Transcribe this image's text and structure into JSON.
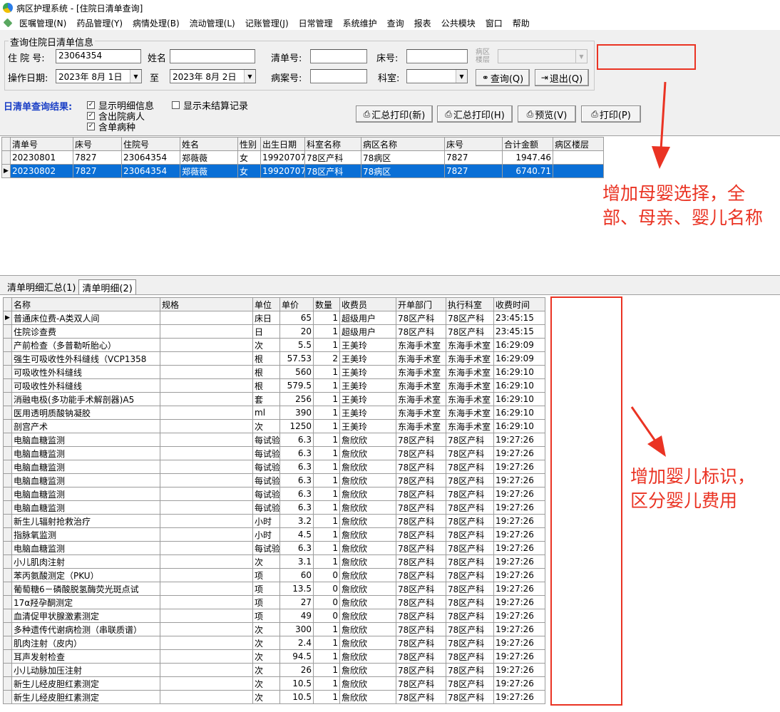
{
  "window": {
    "title": "病区护理系统 - [住院日清单查询]"
  },
  "menu": [
    "医嘱管理(N)",
    "药品管理(Y)",
    "病情处理(B)",
    "流动管理(L)",
    "记账管理(J)",
    "日常管理",
    "系统维护",
    "查询",
    "报表",
    "公共模块",
    "窗口",
    "帮助"
  ],
  "query": {
    "group_title": "查询住院日清单信息",
    "admission_no_label": "住 院 号:",
    "admission_no": "23064354",
    "name_label": "姓名",
    "name_value": "",
    "list_no_label": "清单号:",
    "list_no": "",
    "bed_no_label": "床号:",
    "bed_no": "",
    "ward_floor_label_1": "病区",
    "ward_floor_label_2": "楼层",
    "ward_floor": "",
    "op_date_label": "操作日期:",
    "date_from": "2023年 8月 1日",
    "to_label": "至",
    "date_to": "2023年 8月 2日",
    "case_no_label": "病案号:",
    "case_no": "",
    "dept_label": "科室:",
    "dept": "",
    "query_btn": "查询(Q)",
    "exit_btn": "退出(Q)"
  },
  "results": {
    "label": "日清单查询结果:",
    "checks": [
      {
        "label": "显示明细信息",
        "checked": true
      },
      {
        "label": "含出院病人",
        "checked": true
      },
      {
        "label": "含单病种",
        "checked": true
      },
      {
        "label": "显示未结算记录",
        "checked": false
      }
    ],
    "buttons": [
      "汇总打印(新)",
      "汇总打印(H)",
      "预览(V)",
      "打印(P)"
    ]
  },
  "summary_table": {
    "headers": [
      "清单号",
      "床号",
      "住院号",
      "姓名",
      "性别",
      "出生日期",
      "科室名称",
      "病区名称",
      "床号",
      "合计金额",
      "病区楼层"
    ],
    "rows": [
      [
        "20230801",
        "7827",
        "23064354",
        "郑薇薇",
        "女",
        "19920707",
        "78区产科",
        "78病区",
        "7827",
        "1947.46",
        ""
      ],
      [
        "20230802",
        "7827",
        "23064354",
        "郑薇薇",
        "女",
        "19920707",
        "78区产科",
        "78病区",
        "7827",
        "6740.71",
        ""
      ]
    ],
    "selected_row": 1
  },
  "tabs": [
    "清单明细汇总(1)",
    "清单明细(2)"
  ],
  "active_tab": 1,
  "detail_table": {
    "headers": [
      "名称",
      "规格",
      "单位",
      "单价",
      "数量",
      "收费员",
      "开单部门",
      "执行科室",
      "收费时间"
    ],
    "rows": [
      [
        "普通床位费-A类双人间",
        "",
        "床日",
        "65",
        "1",
        "超级用户",
        "78区产科",
        "78区产科",
        "23:45:15"
      ],
      [
        "住院诊查费",
        "",
        "日",
        "20",
        "1",
        "超级用户",
        "78区产科",
        "78区产科",
        "23:45:15"
      ],
      [
        "产前检查（多普勒听胎心）",
        "",
        "次",
        "5.5",
        "1",
        "王美玲",
        "东海手术室",
        "东海手术室",
        "16:29:09"
      ],
      [
        "强生可吸收性外科缝线（VCP1358",
        "",
        "根",
        "57.53",
        "2",
        "王美玲",
        "东海手术室",
        "东海手术室",
        "16:29:09"
      ],
      [
        "可吸收性外科缝线",
        "",
        "根",
        "560",
        "1",
        "王美玲",
        "东海手术室",
        "东海手术室",
        "16:29:10"
      ],
      [
        "可吸收性外科缝线",
        "",
        "根",
        "579.5",
        "1",
        "王美玲",
        "东海手术室",
        "东海手术室",
        "16:29:10"
      ],
      [
        "消融电极(多功能手术解剖器)A5",
        "",
        "套",
        "256",
        "1",
        "王美玲",
        "东海手术室",
        "东海手术室",
        "16:29:10"
      ],
      [
        "医用透明质酸钠凝胶",
        "",
        "ml",
        "390",
        "1",
        "王美玲",
        "东海手术室",
        "东海手术室",
        "16:29:10"
      ],
      [
        "剖宫产术",
        "",
        "次",
        "1250",
        "1",
        "王美玲",
        "东海手术室",
        "东海手术室",
        "16:29:10"
      ],
      [
        "电脑血糖监测",
        "",
        "每试验",
        "6.3",
        "1",
        "詹欣欣",
        "78区产科",
        "78区产科",
        "19:27:26"
      ],
      [
        "电脑血糖监测",
        "",
        "每试验",
        "6.3",
        "1",
        "詹欣欣",
        "78区产科",
        "78区产科",
        "19:27:26"
      ],
      [
        "电脑血糖监测",
        "",
        "每试验",
        "6.3",
        "1",
        "詹欣欣",
        "78区产科",
        "78区产科",
        "19:27:26"
      ],
      [
        "电脑血糖监测",
        "",
        "每试验",
        "6.3",
        "1",
        "詹欣欣",
        "78区产科",
        "78区产科",
        "19:27:26"
      ],
      [
        "电脑血糖监测",
        "",
        "每试验",
        "6.3",
        "1",
        "詹欣欣",
        "78区产科",
        "78区产科",
        "19:27:26"
      ],
      [
        "电脑血糖监测",
        "",
        "每试验",
        "6.3",
        "1",
        "詹欣欣",
        "78区产科",
        "78区产科",
        "19:27:26"
      ],
      [
        "新生儿辐射抢救治疗",
        "",
        "小时",
        "3.2",
        "1",
        "詹欣欣",
        "78区产科",
        "78区产科",
        "19:27:26"
      ],
      [
        "指脉氧监测",
        "",
        "小时",
        "4.5",
        "1",
        "詹欣欣",
        "78区产科",
        "78区产科",
        "19:27:26"
      ],
      [
        "电脑血糖监测",
        "",
        "每试验",
        "6.3",
        "1",
        "詹欣欣",
        "78区产科",
        "78区产科",
        "19:27:26"
      ],
      [
        "小儿肌肉注射",
        "",
        "次",
        "3.1",
        "1",
        "詹欣欣",
        "78区产科",
        "78区产科",
        "19:27:26"
      ],
      [
        "苯丙氨酸测定（PKU）",
        "",
        "项",
        "60",
        "0",
        "詹欣欣",
        "78区产科",
        "78区产科",
        "19:27:26"
      ],
      [
        "葡萄糖6－磷酸脱氢酶荧光斑点试",
        "",
        "项",
        "13.5",
        "0",
        "詹欣欣",
        "78区产科",
        "78区产科",
        "19:27:26"
      ],
      [
        "17α羟孕酮测定",
        "",
        "项",
        "27",
        "0",
        "詹欣欣",
        "78区产科",
        "78区产科",
        "19:27:26"
      ],
      [
        "血清促甲状腺激素测定",
        "",
        "项",
        "49",
        "0",
        "詹欣欣",
        "78区产科",
        "78区产科",
        "19:27:26"
      ],
      [
        "多种遗传代谢病检测（串联质谱）",
        "",
        "次",
        "300",
        "1",
        "詹欣欣",
        "78区产科",
        "78区产科",
        "19:27:26"
      ],
      [
        "肌肉注射（皮内）",
        "",
        "次",
        "2.4",
        "1",
        "詹欣欣",
        "78区产科",
        "78区产科",
        "19:27:26"
      ],
      [
        "耳声发射检查",
        "",
        "次",
        "94.5",
        "1",
        "詹欣欣",
        "78区产科",
        "78区产科",
        "19:27:26"
      ],
      [
        "小儿动脉加压注射",
        "",
        "次",
        "26",
        "1",
        "詹欣欣",
        "78区产科",
        "78区产科",
        "19:27:26"
      ],
      [
        "新生儿经皮胆红素测定",
        "",
        "次",
        "10.5",
        "1",
        "詹欣欣",
        "78区产科",
        "78区产科",
        "19:27:26"
      ],
      [
        "新生儿经皮胆红素测定",
        "",
        "次",
        "10.5",
        "1",
        "詹欣欣",
        "78区产科",
        "78区产科",
        "19:27:26"
      ]
    ]
  },
  "annotations": {
    "top_1": "增加母婴选择，全",
    "top_2": "部、母亲、婴儿名称",
    "bottom_1": "增加婴儿标识，",
    "bottom_2": "区分婴儿费用"
  },
  "colors": {
    "annotation": "#ea3323",
    "selection": "#0a6fd6"
  }
}
